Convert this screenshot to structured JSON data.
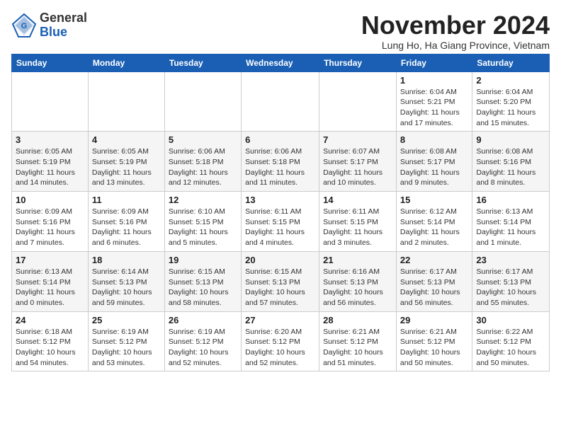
{
  "header": {
    "logo_general": "General",
    "logo_blue": "Blue",
    "month_title": "November 2024",
    "location": "Lung Ho, Ha Giang Province, Vietnam"
  },
  "weekdays": [
    "Sunday",
    "Monday",
    "Tuesday",
    "Wednesday",
    "Thursday",
    "Friday",
    "Saturday"
  ],
  "weeks": [
    [
      {
        "day": "",
        "info": ""
      },
      {
        "day": "",
        "info": ""
      },
      {
        "day": "",
        "info": ""
      },
      {
        "day": "",
        "info": ""
      },
      {
        "day": "",
        "info": ""
      },
      {
        "day": "1",
        "info": "Sunrise: 6:04 AM\nSunset: 5:21 PM\nDaylight: 11 hours and 17 minutes."
      },
      {
        "day": "2",
        "info": "Sunrise: 6:04 AM\nSunset: 5:20 PM\nDaylight: 11 hours and 15 minutes."
      }
    ],
    [
      {
        "day": "3",
        "info": "Sunrise: 6:05 AM\nSunset: 5:19 PM\nDaylight: 11 hours and 14 minutes."
      },
      {
        "day": "4",
        "info": "Sunrise: 6:05 AM\nSunset: 5:19 PM\nDaylight: 11 hours and 13 minutes."
      },
      {
        "day": "5",
        "info": "Sunrise: 6:06 AM\nSunset: 5:18 PM\nDaylight: 11 hours and 12 minutes."
      },
      {
        "day": "6",
        "info": "Sunrise: 6:06 AM\nSunset: 5:18 PM\nDaylight: 11 hours and 11 minutes."
      },
      {
        "day": "7",
        "info": "Sunrise: 6:07 AM\nSunset: 5:17 PM\nDaylight: 11 hours and 10 minutes."
      },
      {
        "day": "8",
        "info": "Sunrise: 6:08 AM\nSunset: 5:17 PM\nDaylight: 11 hours and 9 minutes."
      },
      {
        "day": "9",
        "info": "Sunrise: 6:08 AM\nSunset: 5:16 PM\nDaylight: 11 hours and 8 minutes."
      }
    ],
    [
      {
        "day": "10",
        "info": "Sunrise: 6:09 AM\nSunset: 5:16 PM\nDaylight: 11 hours and 7 minutes."
      },
      {
        "day": "11",
        "info": "Sunrise: 6:09 AM\nSunset: 5:16 PM\nDaylight: 11 hours and 6 minutes."
      },
      {
        "day": "12",
        "info": "Sunrise: 6:10 AM\nSunset: 5:15 PM\nDaylight: 11 hours and 5 minutes."
      },
      {
        "day": "13",
        "info": "Sunrise: 6:11 AM\nSunset: 5:15 PM\nDaylight: 11 hours and 4 minutes."
      },
      {
        "day": "14",
        "info": "Sunrise: 6:11 AM\nSunset: 5:15 PM\nDaylight: 11 hours and 3 minutes."
      },
      {
        "day": "15",
        "info": "Sunrise: 6:12 AM\nSunset: 5:14 PM\nDaylight: 11 hours and 2 minutes."
      },
      {
        "day": "16",
        "info": "Sunrise: 6:13 AM\nSunset: 5:14 PM\nDaylight: 11 hours and 1 minute."
      }
    ],
    [
      {
        "day": "17",
        "info": "Sunrise: 6:13 AM\nSunset: 5:14 PM\nDaylight: 11 hours and 0 minutes."
      },
      {
        "day": "18",
        "info": "Sunrise: 6:14 AM\nSunset: 5:13 PM\nDaylight: 10 hours and 59 minutes."
      },
      {
        "day": "19",
        "info": "Sunrise: 6:15 AM\nSunset: 5:13 PM\nDaylight: 10 hours and 58 minutes."
      },
      {
        "day": "20",
        "info": "Sunrise: 6:15 AM\nSunset: 5:13 PM\nDaylight: 10 hours and 57 minutes."
      },
      {
        "day": "21",
        "info": "Sunrise: 6:16 AM\nSunset: 5:13 PM\nDaylight: 10 hours and 56 minutes."
      },
      {
        "day": "22",
        "info": "Sunrise: 6:17 AM\nSunset: 5:13 PM\nDaylight: 10 hours and 56 minutes."
      },
      {
        "day": "23",
        "info": "Sunrise: 6:17 AM\nSunset: 5:13 PM\nDaylight: 10 hours and 55 minutes."
      }
    ],
    [
      {
        "day": "24",
        "info": "Sunrise: 6:18 AM\nSunset: 5:12 PM\nDaylight: 10 hours and 54 minutes."
      },
      {
        "day": "25",
        "info": "Sunrise: 6:19 AM\nSunset: 5:12 PM\nDaylight: 10 hours and 53 minutes."
      },
      {
        "day": "26",
        "info": "Sunrise: 6:19 AM\nSunset: 5:12 PM\nDaylight: 10 hours and 52 minutes."
      },
      {
        "day": "27",
        "info": "Sunrise: 6:20 AM\nSunset: 5:12 PM\nDaylight: 10 hours and 52 minutes."
      },
      {
        "day": "28",
        "info": "Sunrise: 6:21 AM\nSunset: 5:12 PM\nDaylight: 10 hours and 51 minutes."
      },
      {
        "day": "29",
        "info": "Sunrise: 6:21 AM\nSunset: 5:12 PM\nDaylight: 10 hours and 50 minutes."
      },
      {
        "day": "30",
        "info": "Sunrise: 6:22 AM\nSunset: 5:12 PM\nDaylight: 10 hours and 50 minutes."
      }
    ]
  ]
}
